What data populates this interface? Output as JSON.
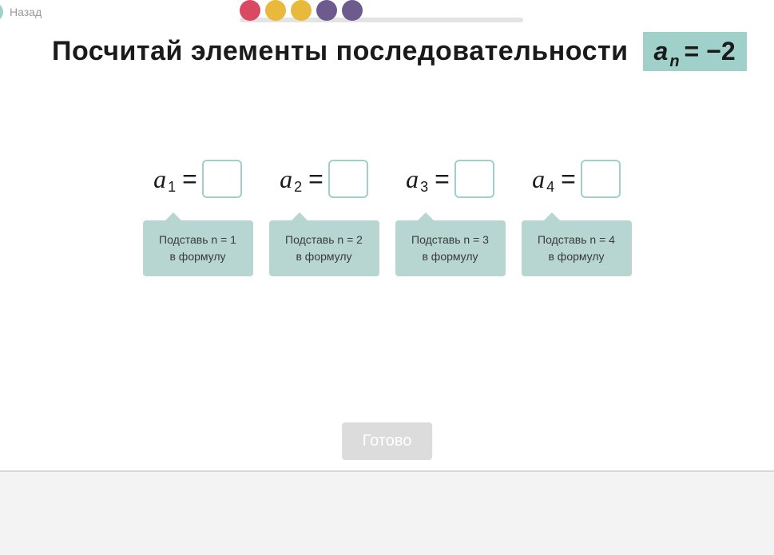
{
  "back_label": "Назад",
  "progress_dots": [
    "red",
    "yellow",
    "yellow",
    "purple",
    "purple"
  ],
  "title": "Посчитай элементы последовательности",
  "formula": {
    "base": "a",
    "sub": "n",
    "rest": "= −2"
  },
  "items": [
    {
      "letter": "a",
      "sub": "1",
      "eq": "=",
      "value": "",
      "hint_line1": "Подставь n = 1",
      "hint_line2": "в формулу"
    },
    {
      "letter": "a",
      "sub": "2",
      "eq": "=",
      "value": "",
      "hint_line1": "Подставь n = 2",
      "hint_line2": "в формулу"
    },
    {
      "letter": "a",
      "sub": "3",
      "eq": "=",
      "value": "",
      "hint_line1": "Подставь n = 3",
      "hint_line2": "в формулу"
    },
    {
      "letter": "a",
      "sub": "4",
      "eq": "=",
      "value": "",
      "hint_line1": "Подставь n = 4",
      "hint_line2": "в формулу"
    }
  ],
  "done_label": "Готово"
}
